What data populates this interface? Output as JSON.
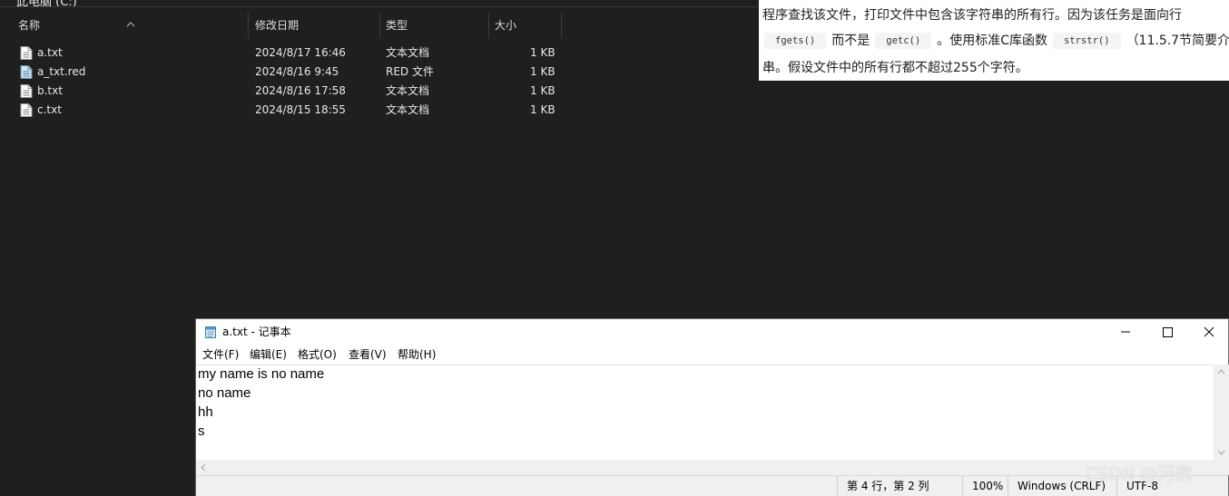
{
  "explorer": {
    "top_partial_title": "此电脑 (C:)",
    "columns": {
      "name": "名称",
      "modified": "修改日期",
      "type": "类型",
      "size": "大小"
    },
    "files": [
      {
        "name": "a.txt",
        "modified": "2024/8/17 16:46",
        "type": "文本文档",
        "size": "1 KB",
        "icon": "text-file-icon"
      },
      {
        "name": "a_txt.red",
        "modified": "2024/8/16 9:45",
        "type": "RED 文件",
        "size": "1 KB",
        "icon": "generic-file-icon"
      },
      {
        "name": "b.txt",
        "modified": "2024/8/16 17:58",
        "type": "文本文档",
        "size": "1 KB",
        "icon": "text-file-icon"
      },
      {
        "name": "c.txt",
        "modified": "2024/8/15 18:55",
        "type": "文本文档",
        "size": "1 KB",
        "icon": "text-file-icon"
      }
    ]
  },
  "doc": {
    "line1": "程序查找该文件，打印文件中包含该字符串的所有行。因为该任务是面向行",
    "code1": "fgets()",
    "text2": "而不是",
    "code2": "getc()",
    "text3": "。使用标准C库函数",
    "code3": "strstr()",
    "text4": "（11.5.7节简要介",
    "line3": "串。假设文件中的所有行都不超过255个字符。"
  },
  "notepad": {
    "title": "a.txt - 记事本",
    "menu": [
      "文件(F)",
      "编辑(E)",
      "格式(O)",
      "查看(V)",
      "帮助(H)"
    ],
    "lines": [
      "my name is no name",
      "no name",
      "hh",
      "s"
    ],
    "status": {
      "position": "第 4 行，第 2 列",
      "zoom": "100%",
      "line_ending": "Windows (CRLF)",
      "encoding": "UTF-8"
    }
  },
  "watermark": "CSDN @河佛"
}
